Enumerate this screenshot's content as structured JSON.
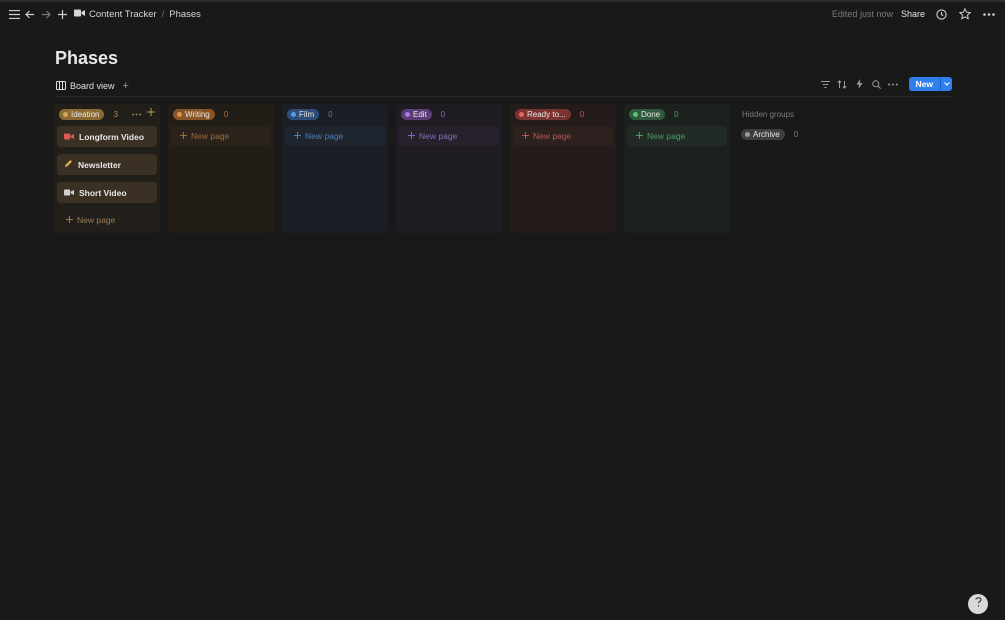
{
  "topbar": {
    "breadcrumb": [
      "Content Tracker",
      "Phases"
    ],
    "edited": "Edited just now",
    "share": "Share",
    "icons": [
      "menu-icon",
      "back-arrow-icon",
      "forward-arrow-icon",
      "plus-icon",
      "video-camera-icon",
      "clock-icon",
      "star-icon",
      "more-icon"
    ]
  },
  "page": {
    "title": "Phases"
  },
  "viewbar": {
    "view_label": "Board view",
    "add": "+",
    "new_label": "New"
  },
  "board": {
    "columns": [
      {
        "label": "Ideation",
        "count": "3",
        "cards": [
          {
            "title": "Longform Video",
            "icon": "video-camera-icon"
          },
          {
            "title": "Newsletter",
            "icon": "pencil-icon"
          },
          {
            "title": "Short Video",
            "icon": "video-camera-icon"
          }
        ],
        "new_page": "New page"
      },
      {
        "label": "Writing",
        "count": "0",
        "new_page": "New page"
      },
      {
        "label": "Film",
        "count": "0",
        "new_page": "New page"
      },
      {
        "label": "Edit",
        "count": "0",
        "new_page": "New page"
      },
      {
        "label": "Ready to...",
        "count": "0",
        "new_page": "New page"
      },
      {
        "label": "Done",
        "count": "0",
        "new_page": "New page"
      }
    ],
    "hidden_groups": {
      "label": "Hidden groups",
      "items": [
        {
          "label": "Archive",
          "count": "0"
        }
      ]
    }
  },
  "colors": {
    "accent": "#2f80ed",
    "background": "#191919"
  }
}
